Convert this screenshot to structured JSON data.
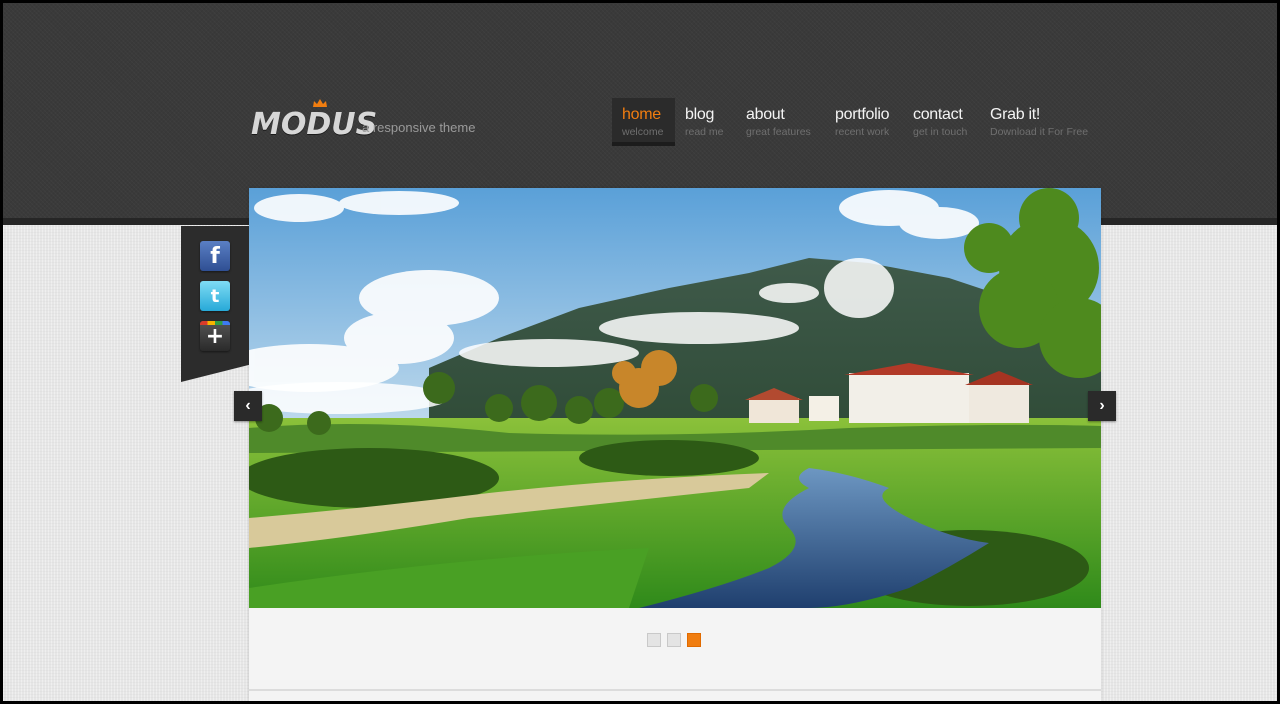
{
  "brand": {
    "logo_text": "MODUS",
    "tagline": "a responsive theme",
    "accent_color": "#f07d10"
  },
  "nav": {
    "items": [
      {
        "label": "home",
        "sub": "welcome",
        "active": true
      },
      {
        "label": "blog",
        "sub": "read me",
        "active": false
      },
      {
        "label": "about",
        "sub": "great features",
        "active": false
      },
      {
        "label": "portfolio",
        "sub": "recent work",
        "active": false
      },
      {
        "label": "contact",
        "sub": "get in touch",
        "active": false
      },
      {
        "label": "Grab it!",
        "sub": "Download it For Free",
        "active": false
      }
    ]
  },
  "social": {
    "facebook_glyph": "f",
    "twitter_glyph": "t",
    "googleplus_glyph": "+",
    "icons": [
      "facebook-icon",
      "twitter-icon",
      "google-plus-icon"
    ]
  },
  "slider": {
    "image_subject": "landscape",
    "prev_glyph": "‹",
    "next_glyph": "›",
    "slide_count": 3,
    "active_slide": 3
  }
}
